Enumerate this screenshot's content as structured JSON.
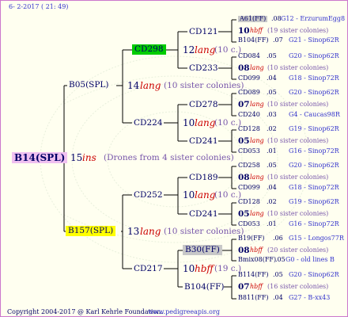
{
  "header": {
    "date": "6- 2-2017 ( 21: 49)"
  },
  "footer": {
    "copyright": "Copyright 2004-2017 @ Karl Kehrle Foundation.",
    "url": "www.pedigreeapis.org"
  },
  "colors": {
    "root_bg": "#f0c0f0",
    "b157_bg": "#ffff00",
    "cd298_bg": "#00cc00",
    "b30_bg": "#c8c8c8",
    "a61_bg": "#c8c8c8",
    "lines": "#000000",
    "accent_red": "#cc0000",
    "link_blue": "#3333cc"
  },
  "root": {
    "name": "B14(SPL)",
    "num": "15",
    "sub": "ins",
    "note": "(Drones from 4 sister colonies)"
  },
  "gen1": {
    "top": {
      "name": "B05(SPL)",
      "num": "14",
      "sub": "lang",
      "note": "(10 sister colonies)"
    },
    "bottom": {
      "name": "B157(SPL)",
      "num": "13",
      "sub": "lang",
      "note": "(10 sister colonies)"
    }
  },
  "gen2": {
    "cd298": {
      "name": "CD298",
      "num": "12",
      "sub": "lang",
      "note": "(10 c.)"
    },
    "cd224": {
      "name": "CD224",
      "num": "10",
      "sub": "lang",
      "note": "(10 c.)"
    },
    "cd252": {
      "name": "CD252",
      "num": "10",
      "sub": "lang",
      "note": "(10 c.)"
    },
    "cd217": {
      "name": "CD217",
      "num": "10",
      "sub": "hbff",
      "note": "(19 c.)"
    }
  },
  "gen3": {
    "cd121": "CD121",
    "cd233": "CD233",
    "cd278": "CD278",
    "cd241a": "CD241",
    "cd189": "CD189",
    "cd241b": "CD241",
    "b30": "B30(FF)",
    "b104": "B104(FF)"
  },
  "gen3_notes": {
    "n1": {
      "num": "10",
      "sub": "hbff",
      "note": "(19 sister colonies)"
    },
    "n2": {
      "num": "08",
      "sub": "lang",
      "note": "(10 sister colonies)"
    },
    "n3": {
      "num": "07",
      "sub": "lang",
      "note": "(10 sister colonies)"
    },
    "n4": {
      "num": "05",
      "sub": "lang",
      "note": "(10 sister colonies)"
    },
    "n5": {
      "num": "08",
      "sub": "lang",
      "note": "(10 sister colonies)"
    },
    "n6": {
      "num": "05",
      "sub": "lang",
      "note": "(10 sister colonies)"
    },
    "n7": {
      "num": "08",
      "sub": "hbff",
      "note": "(20 sister colonies)"
    },
    "n8": {
      "num": "07",
      "sub": "hbff",
      "note": "(16 sister colonies)"
    }
  },
  "gen4": [
    {
      "name": "A61(FF)",
      "year": ".08",
      "info": "G12 - ErzurumEgg8"
    },
    {
      "name": "B104(FF)",
      "year": ".07",
      "info": "G21 - Sinop62R"
    },
    {
      "name": "CD084",
      "year": ".05",
      "info": "G20 - Sinop62R"
    },
    {
      "name": "CD099",
      "year": ".04",
      "info": "G18 - Sinop72R"
    },
    {
      "name": "CD089",
      "year": ".05",
      "info": "G20 - Sinop62R"
    },
    {
      "name": "CD240",
      "year": ".03",
      "info": "G4 - Caucas98R"
    },
    {
      "name": "CD128",
      "year": ".02",
      "info": "G19 - Sinop62R"
    },
    {
      "name": "CD053",
      "year": ".01",
      "info": "G16 - Sinop72R"
    },
    {
      "name": "CD258",
      "year": ".05",
      "info": "G20 - Sinop62R"
    },
    {
      "name": "CD099",
      "year": ".04",
      "info": "G18 - Sinop72R"
    },
    {
      "name": "CD128",
      "year": ".02",
      "info": "G19 - Sinop62R"
    },
    {
      "name": "CD053",
      "year": ".01",
      "info": "G16 - Sinop72R"
    },
    {
      "name": "B19(FF)",
      "year": ".06",
      "info": "G15 - Longos77R"
    },
    {
      "name": "Bmix08(FF)",
      "year": ".05",
      "info": "G0 - old lines B"
    },
    {
      "name": "B114(FF)",
      "year": ".05",
      "info": "G20 - Sinop62R"
    },
    {
      "name": "B811(FF)",
      "year": ".04",
      "info": "G27 - B-xx43"
    }
  ]
}
